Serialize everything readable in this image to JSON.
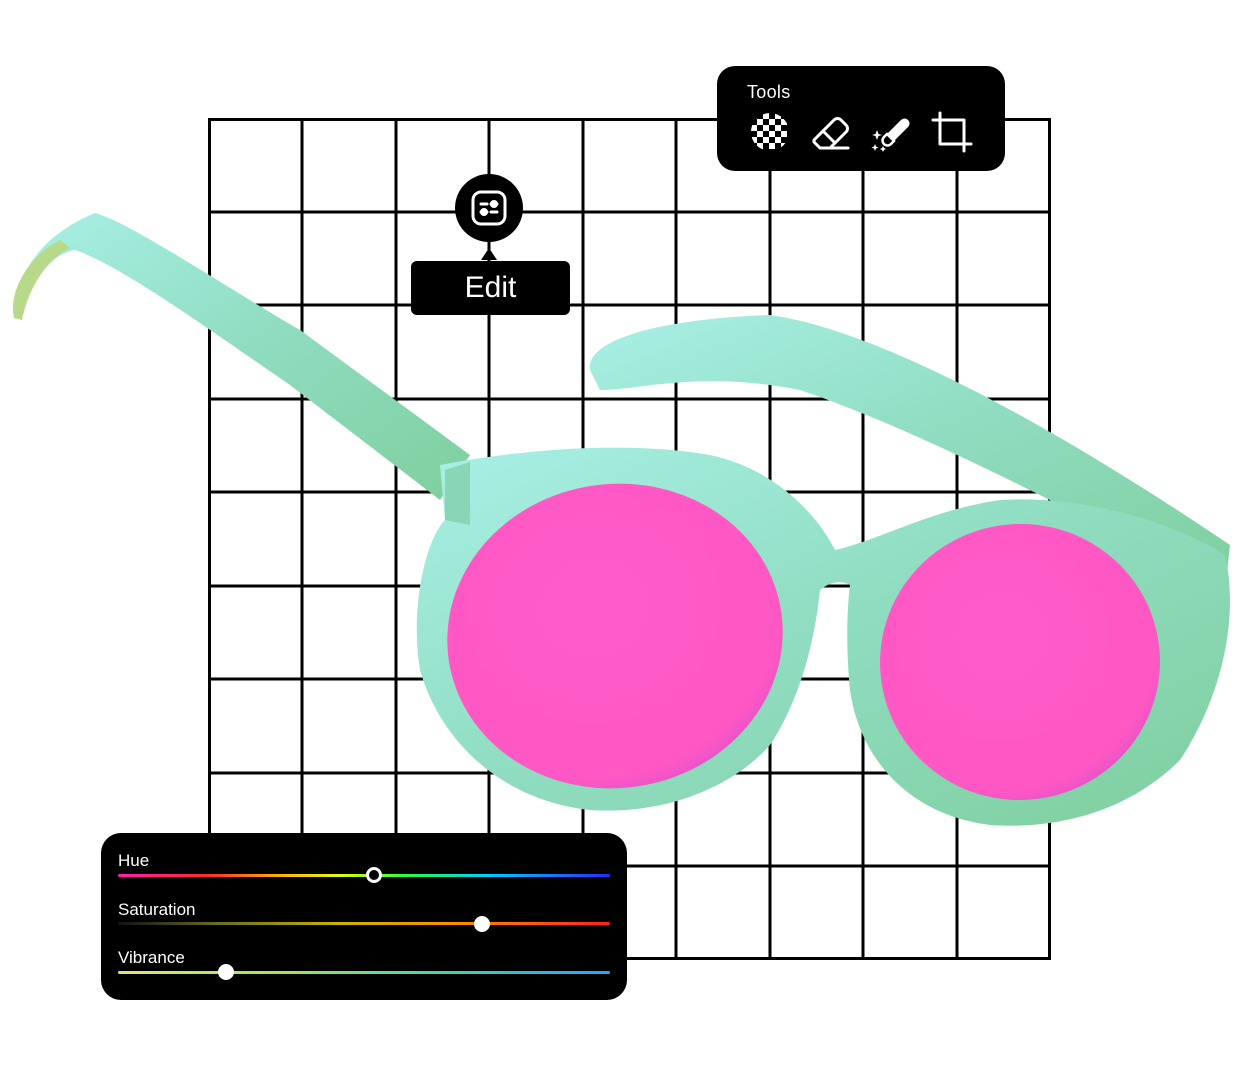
{
  "tools_panel": {
    "title": "Tools",
    "items": [
      {
        "icon": "transparency-checker-icon"
      },
      {
        "icon": "eraser-icon"
      },
      {
        "icon": "magic-eraser-icon"
      },
      {
        "icon": "crop-icon"
      }
    ]
  },
  "edit_tooltip": {
    "icon": "adjustments-icon",
    "label": "Edit"
  },
  "adjust_panel": {
    "sliders": [
      {
        "label": "Hue",
        "value": 0.52
      },
      {
        "label": "Saturation",
        "value": 0.74
      },
      {
        "label": "Vibrance",
        "value": 0.22
      }
    ]
  },
  "colors": {
    "frame": "#9be3c8",
    "lens": "#ff5cc8",
    "panel": "#000000"
  }
}
